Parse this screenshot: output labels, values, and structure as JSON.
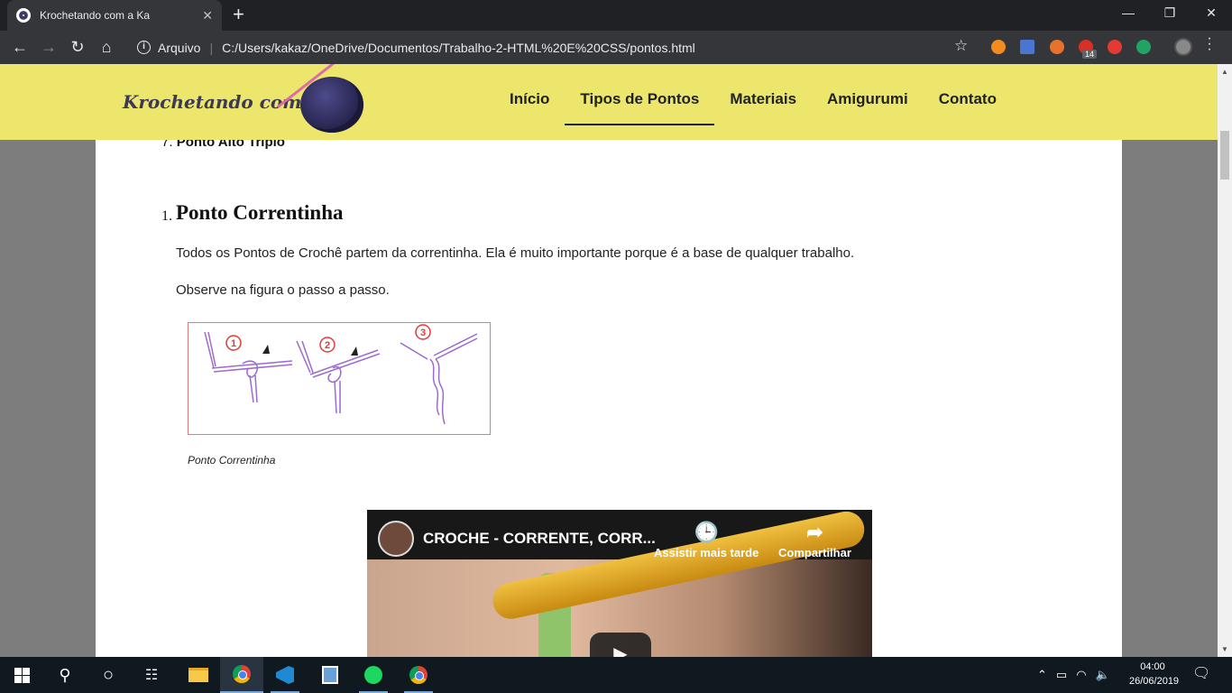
{
  "browser": {
    "tab_title": "Krochetando com a Ka",
    "tab_close": "✕",
    "new_tab": "+",
    "window_controls": [
      "—",
      "❐",
      "✕"
    ],
    "nav": {
      "back": "←",
      "forward": "→",
      "reload": "↻",
      "home": "⌂"
    },
    "address_scheme": "Arquivo",
    "address_url": "C:/Users/kakaz/OneDrive/Documentos/Trabalho-2-HTML%20E%20CSS/pontos.html",
    "extension_badge": "14",
    "extension_colors": [
      "#f28b20",
      "#4a76d1",
      "#e8712d",
      "#d93025",
      "#e53935",
      "#1fa463"
    ]
  },
  "site": {
    "logo_text": "Krochetando com a Ka",
    "nav": [
      {
        "label": "Início"
      },
      {
        "label": "Tipos de Pontos",
        "active": true
      },
      {
        "label": "Materiais"
      },
      {
        "label": "Amigurumi"
      },
      {
        "label": "Contato"
      }
    ]
  },
  "content": {
    "list_item_7_number": "7.",
    "list_item_7": "Ponto Alto Triplo",
    "section_number": "1.",
    "section_title": "Ponto Correntinha",
    "paragraph_1": "Todos os Pontos de Crochê partem da correntinha. Ela é muito importante porque é a base de qualquer trabalho.",
    "paragraph_2": "Observe na figura o passo a passo.",
    "figure_steps": [
      "1",
      "2",
      "3"
    ],
    "figure_caption": "Ponto Correntinha"
  },
  "video": {
    "title": "CROCHE - CORRENTE, CORR...",
    "watch_later": "Assistir mais tarde",
    "share": "Compartilhar"
  },
  "taskbar": {
    "time": "04:00",
    "date": "26/06/2019"
  }
}
